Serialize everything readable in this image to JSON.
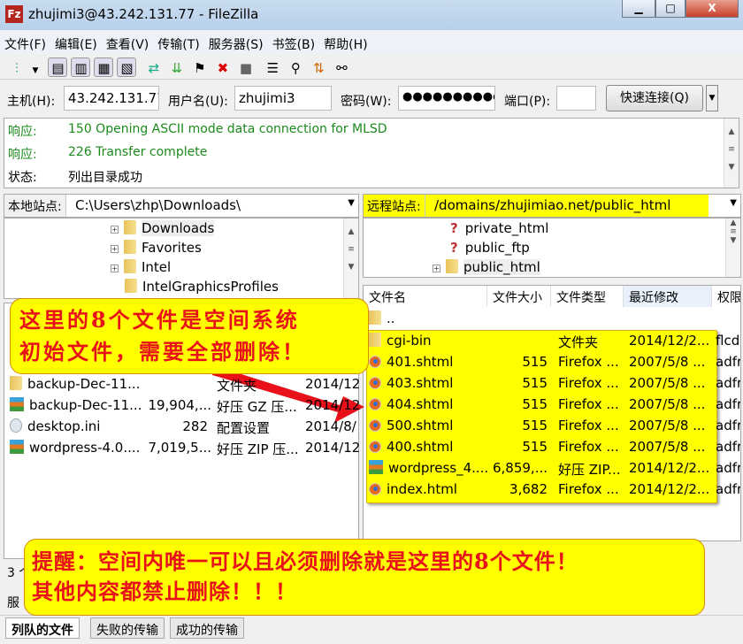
{
  "window": {
    "title": "zhujimi3@43.242.131.77 - FileZilla",
    "app_icon": "filezilla-icon",
    "controls": [
      "minimize",
      "maximize",
      "close"
    ]
  },
  "menu": [
    "文件(F)",
    "编辑(E)",
    "查看(V)",
    "传输(T)",
    "服务器(S)",
    "书签(B)",
    "帮助(H)"
  ],
  "toolbar": [
    "site-manager-icon",
    "dropdown-icon",
    "toggle-log-icon",
    "toggle-local-tree-icon",
    "toggle-remote-tree-icon",
    "toggle-queue-icon",
    "refresh-icon",
    "process-queue-icon",
    "cancel-icon",
    "disconnect-icon",
    "reconnect-icon",
    "filter-icon",
    "compare-icon",
    "sync-browse-icon",
    "search-icon"
  ],
  "quickconnect": {
    "host_label": "主机(H):",
    "host": "43.242.131.77",
    "user_label": "用户名(U):",
    "user": "zhujimi3",
    "pass_label": "密码(W):",
    "pass": "●●●●●●●●●●",
    "port_label": "端口(P):",
    "port": "",
    "button": "快速连接(Q)"
  },
  "log": [
    {
      "key": "响应:",
      "text": "150 Opening ASCII mode data connection for MLSD",
      "color": "#1c8a1c"
    },
    {
      "key": "响应:",
      "text": "226 Transfer complete",
      "color": "#1c8a1c"
    },
    {
      "key": "状态:",
      "text": "列出目录成功",
      "color": "#000000"
    }
  ],
  "local": {
    "site_label": "本地站点:",
    "path": "C:\\Users\\zhp\\Downloads\\",
    "tree": [
      "Downloads",
      "Favorites",
      "Intel",
      "IntelGraphicsProfiles"
    ],
    "files": [
      {
        "name": "backup-Dec-11...",
        "size": "",
        "type": "文件夹",
        "date": "2014/12"
      },
      {
        "name": "backup-Dec-11...",
        "size": "19,904,...",
        "type": "好压 GZ 压...",
        "date": "2014/12"
      },
      {
        "name": "desktop.ini",
        "size": "282",
        "type": "配置设置",
        "date": "2014/8/"
      },
      {
        "name": "wordpress-4.0....",
        "size": "7,019,5...",
        "type": "好压 ZIP 压...",
        "date": "2014/12"
      }
    ],
    "status": "3 个"
  },
  "remote": {
    "site_label": "远程站点:",
    "path": "/domains/zhujimiao.net/public_html",
    "tree": [
      "private_html",
      "public_ftp",
      "public_html"
    ],
    "columns": [
      "文件名",
      "文件大小",
      "文件类型",
      "最近修改",
      "权限"
    ],
    "parent": "..",
    "files": [
      {
        "name": "cgi-bin",
        "size": "",
        "type": "文件夹",
        "date": "2014/12/2...",
        "perm": "flcd",
        "icon": "folder"
      },
      {
        "name": "401.shtml",
        "size": "515",
        "type": "Firefox ...",
        "date": "2007/5/8 ...",
        "perm": "adfr",
        "icon": "firefox"
      },
      {
        "name": "403.shtml",
        "size": "515",
        "type": "Firefox ...",
        "date": "2007/5/8 ...",
        "perm": "adfr",
        "icon": "firefox"
      },
      {
        "name": "404.shtml",
        "size": "515",
        "type": "Firefox ...",
        "date": "2007/5/8 ...",
        "perm": "adfr",
        "icon": "firefox"
      },
      {
        "name": "500.shtml",
        "size": "515",
        "type": "Firefox ...",
        "date": "2007/5/8 ...",
        "perm": "adfr",
        "icon": "firefox"
      },
      {
        "name": "400.shtml",
        "size": "515",
        "type": "Firefox ...",
        "date": "2007/5/8 ...",
        "perm": "adfr",
        "icon": "firefox"
      },
      {
        "name": "wordpress_4....",
        "size": "6,859,...",
        "type": "好压 ZIP...",
        "date": "2014/12/2...",
        "perm": "adfr",
        "icon": "zip"
      },
      {
        "name": "index.html",
        "size": "3,682",
        "type": "Firefox ...",
        "date": "2014/12/2...",
        "perm": "adfr",
        "icon": "firefox"
      }
    ]
  },
  "queue_label": "服",
  "tabs": [
    "列队的文件",
    "失败的传输",
    "成功的传输"
  ],
  "annotations": {
    "callout1": [
      "这里的8个文件是空间系统",
      "初始文件，需要全部删除！"
    ],
    "callout2": [
      "提醒：空间内唯一可以且必须删除就是这里的8个文件！",
      "其他内容都禁止删除！！！"
    ],
    "highlight_color": "#ffff00",
    "text_color": "#e8111a"
  }
}
